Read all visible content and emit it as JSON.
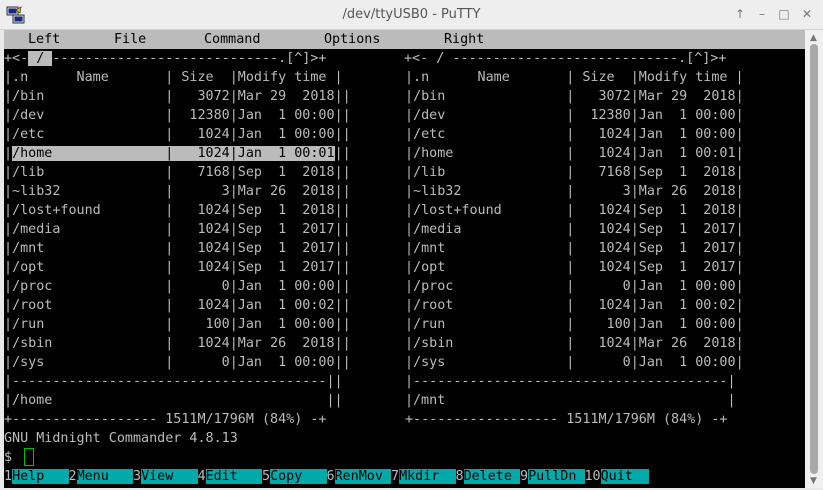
{
  "window": {
    "title": "/dev/ttyUSB0 - PuTTY",
    "controls": [
      "↑",
      "–",
      "□",
      "✕"
    ]
  },
  "menu": [
    "Left",
    "File",
    "Command",
    "Options",
    "Right"
  ],
  "left_panel": {
    "top_border_prefix": "+<-",
    "path_tab": " / ",
    "top_border_suffix": "----------------------------.[^]>+",
    "header": "|.n      Name       | Size  |Modify time |",
    "rows": [
      {
        "name": "/bin",
        "size": "3072",
        "mtime": "Mar 29  2018"
      },
      {
        "name": "/dev",
        "size": "12380",
        "mtime": "Jan  1 00:00"
      },
      {
        "name": "/etc",
        "size": "1024",
        "mtime": "Jan  1 00:00"
      },
      {
        "name": "/home",
        "size": "1024",
        "mtime": "Jan  1 00:01"
      },
      {
        "name": "/lib",
        "size": "7168",
        "mtime": "Sep  1  2018"
      },
      {
        "name": "~lib32",
        "size": "3",
        "mtime": "Mar 26  2018"
      },
      {
        "name": "/lost+found",
        "size": "1024",
        "mtime": "Sep  1  2018"
      },
      {
        "name": "/media",
        "size": "1024",
        "mtime": "Sep  1  2017"
      },
      {
        "name": "/mnt",
        "size": "1024",
        "mtime": "Sep  1  2017"
      },
      {
        "name": "/opt",
        "size": "1024",
        "mtime": "Sep  1  2017"
      },
      {
        "name": "/proc",
        "size": "0",
        "mtime": "Jan  1 00:00"
      },
      {
        "name": "/root",
        "size": "1024",
        "mtime": "Jan  1 00:02"
      },
      {
        "name": "/run",
        "size": "100",
        "mtime": "Jan  1 00:00"
      },
      {
        "name": "/sbin",
        "size": "1024",
        "mtime": "Mar 26  2018"
      },
      {
        "name": "/sys",
        "size": "0",
        "mtime": "Jan  1 00:00"
      }
    ],
    "selected_index": 3,
    "mini_status": "/home",
    "disk": "1511M/1796M (84%)"
  },
  "right_panel": {
    "top_border": "+<- / ----------------------------.[^]>+",
    "mini_status": "/mnt",
    "disk": "1511M/1796M (84%)"
  },
  "version_line": "GNU Midnight Commander 4.8.13",
  "prompt": "$",
  "fkeys": [
    {
      "num": "1",
      "label": "Help"
    },
    {
      "num": "2",
      "label": "Menu"
    },
    {
      "num": "3",
      "label": "View"
    },
    {
      "num": "4",
      "label": "Edit"
    },
    {
      "num": "5",
      "label": "Copy"
    },
    {
      "num": "6",
      "label": "RenMov"
    },
    {
      "num": "7",
      "label": "Mkdir"
    },
    {
      "num": "8",
      "label": "Delete"
    },
    {
      "num": "9",
      "label": "PullDn"
    },
    {
      "num": "10",
      "label": "Quit"
    }
  ],
  "colors": {
    "terminal_bg": "#000000",
    "terminal_fg": "#bbbbbb",
    "highlight_bg": "#bbbbbb",
    "fkey_label_bg": "#00aaaa",
    "cursor": "#00c000"
  }
}
